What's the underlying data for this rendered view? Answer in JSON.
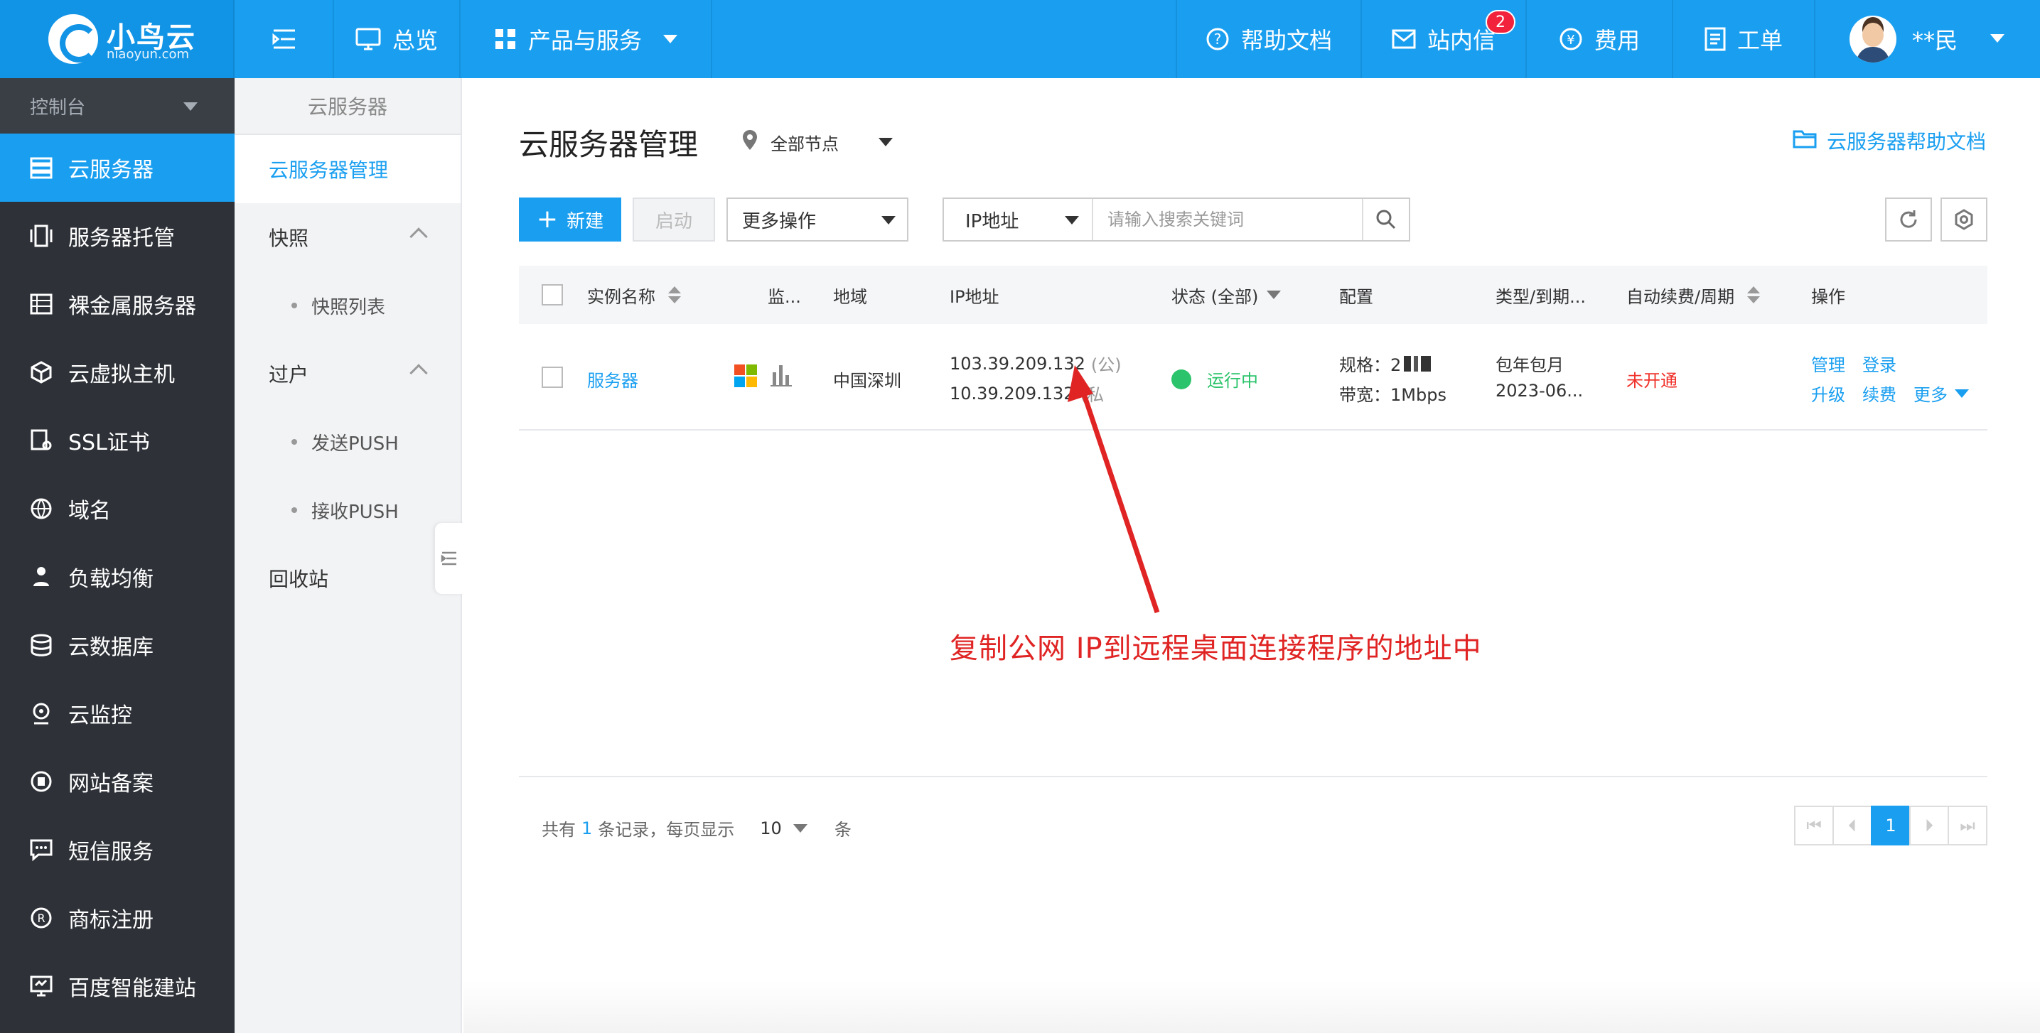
{
  "topbar": {
    "logo_name": "小鸟云",
    "logo_sub": "niaoyun.com",
    "overview": "总览",
    "products": "产品与服务",
    "help_docs": "帮助文档",
    "inbox": "站内信",
    "inbox_count": "2",
    "fees": "费用",
    "ticket": "工单",
    "user": "**民"
  },
  "sidebar": {
    "console": "控制台",
    "items": [
      {
        "label": "云服务器",
        "icon": "server-icon",
        "active": true
      },
      {
        "label": "服务器托管",
        "icon": "hosting-icon"
      },
      {
        "label": "裸金属服务器",
        "icon": "bare-metal-icon"
      },
      {
        "label": "云虚拟主机",
        "icon": "cube-icon"
      },
      {
        "label": "SSL证书",
        "icon": "certificate-icon"
      },
      {
        "label": "域名",
        "icon": "globe-icon"
      },
      {
        "label": "负载均衡",
        "icon": "load-balance-icon"
      },
      {
        "label": "云数据库",
        "icon": "database-icon"
      },
      {
        "label": "云监控",
        "icon": "monitor-icon"
      },
      {
        "label": "网站备案",
        "icon": "record-icon"
      },
      {
        "label": "短信服务",
        "icon": "sms-icon"
      },
      {
        "label": "商标注册",
        "icon": "trademark-icon"
      },
      {
        "label": "百度智能建站",
        "icon": "site-builder-icon"
      }
    ]
  },
  "subnav": {
    "title": "云服务器",
    "manage": "云服务器管理",
    "snapshot": "快照",
    "snapshot_list": "快照列表",
    "transfer": "过户",
    "send_push": "发送PUSH",
    "receive_push": "接收PUSH",
    "recycle": "回收站"
  },
  "main": {
    "title": "云服务器管理",
    "node": "全部节点",
    "help_link": "云服务器帮助文档",
    "new_btn": "新建",
    "start_btn": "启动",
    "more_ops": "更多操作",
    "search_type": "IP地址",
    "search_placeholder": "请输入搜索关键词"
  },
  "table": {
    "headers": {
      "name": "实例名称",
      "monitor": "监...",
      "region": "地域",
      "ip": "IP地址",
      "status": "状态 (全部)",
      "config": "配置",
      "type": "类型/到期...",
      "renew": "自动续费/周期",
      "ops": "操作"
    },
    "rows": [
      {
        "name": "服务器",
        "region": "中国深圳",
        "ip_public": "103.39.209.132",
        "ip_public_tag": "(公)",
        "ip_private": "10.39.209.132",
        "ip_private_tag": "(私",
        "status": "运行中",
        "spec": "规格：2",
        "bandwidth": "带宽：1Mbps",
        "billing": "包年包月",
        "expire": "2023-06...",
        "renew": "未开通",
        "op_manage": "管理",
        "op_login": "登录",
        "op_upgrade": "升级",
        "op_renew": "续费",
        "op_more": "更多"
      }
    ]
  },
  "footer": {
    "total_prefix": "共有",
    "total": "1",
    "total_suffix": "条记录，每页显示",
    "page_size": "10",
    "unit": "条",
    "current_page": "1"
  },
  "annotation": "复制公网 IP到远程桌面连接程序的地址中",
  "colors": {
    "primary": "#1a9ff0",
    "sidebar": "#2e3238",
    "running": "#2bc36b",
    "alert": "#f0322b",
    "annotation": "#e02424"
  }
}
